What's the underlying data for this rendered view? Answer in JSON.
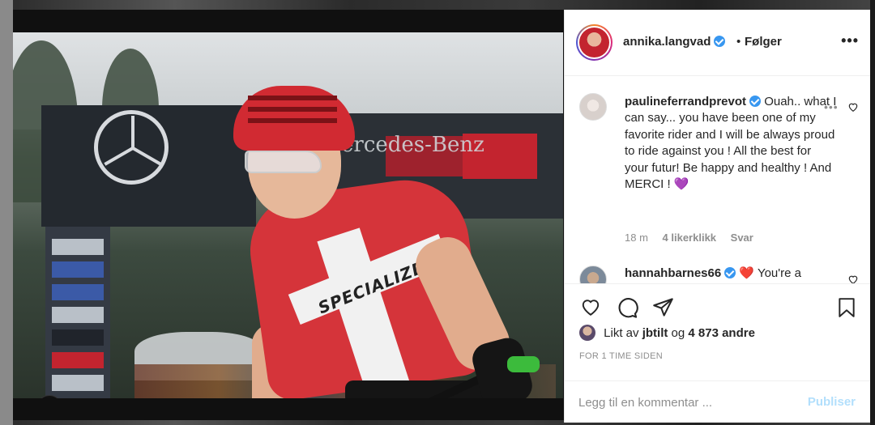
{
  "post": {
    "author": "annika.langvad",
    "follow_status": "Følger",
    "separator": "•",
    "more": "•••"
  },
  "photo": {
    "banner_text": "ercedes-Benz",
    "jersey_text": "SPECIALIZED"
  },
  "comments": [
    {
      "username": "paulineferrandprevot",
      "text": "Ouah.. what I can say... you have been one of my favorite rider and I will be always proud to ride against you ! All the best for your futur! Be happy and healthy ! And MERCI ! 💜",
      "time": "18 m",
      "likes": "4 likerklikk",
      "reply": "Svar",
      "more": "•••"
    },
    {
      "username": "hannahbarnes66",
      "text": "❤️ You're a legend Annika, what an inspiration"
    }
  ],
  "likes": {
    "prefix": "Likt av",
    "first_user": "jbtilt",
    "conjunction": "og",
    "others": "4 873 andre"
  },
  "time_ago": "FOR 1 TIME SIDEN",
  "add_comment": {
    "placeholder": "Legg til en kommentar ...",
    "post_label": "Publiser"
  },
  "colors": {
    "verified": "#3897f0",
    "publish_disabled": "#b2dffc",
    "heart_emoji": "#ed1c24",
    "purple_heart": "#9b4dca"
  }
}
